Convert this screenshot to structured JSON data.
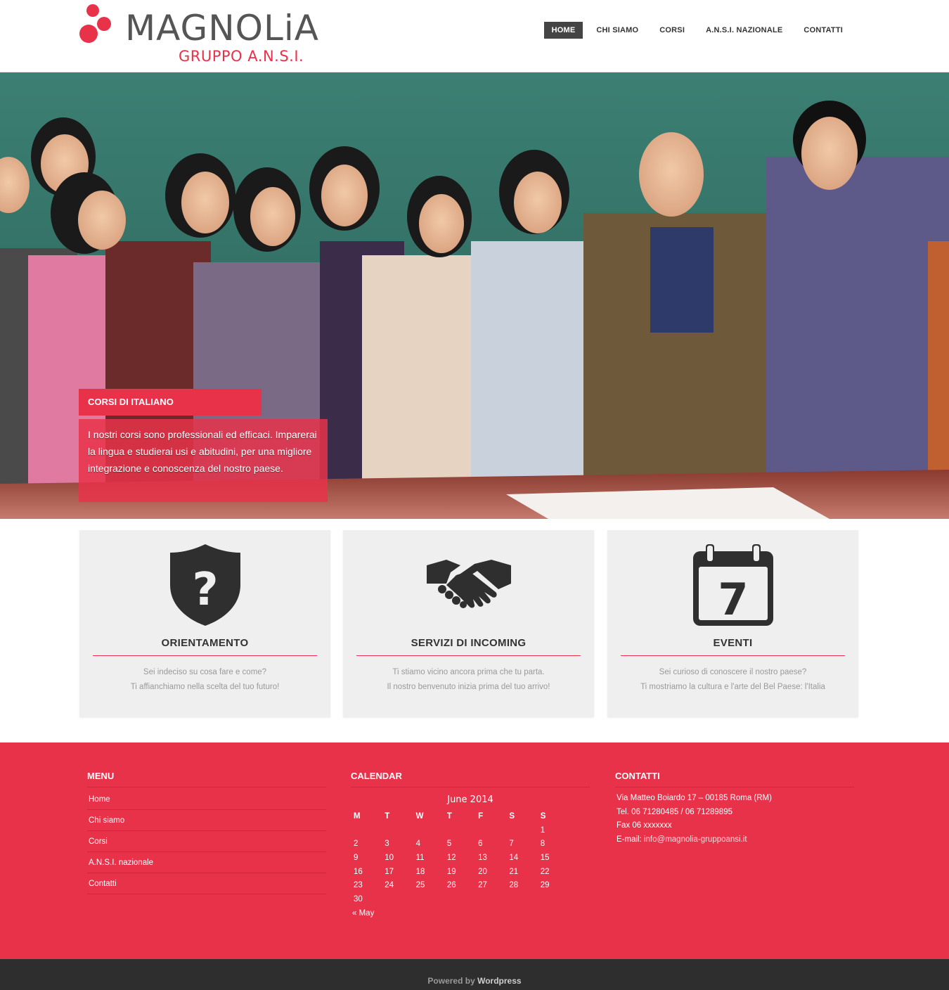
{
  "header": {
    "logo_title": "MAGNOLiA",
    "logo_subtitle": "GRUPPO A.N.S.I.",
    "nav": [
      {
        "label": "HOME",
        "active": true
      },
      {
        "label": "CHI SIAMO",
        "active": false
      },
      {
        "label": "CORSI",
        "active": false
      },
      {
        "label": "A.N.S.I. NAZIONALE",
        "active": false
      },
      {
        "label": "CONTATTI",
        "active": false
      }
    ]
  },
  "hero": {
    "caption_title": "CORSI DI ITALIANO",
    "caption_body": "I nostri corsi sono professionali ed efficaci. Imparerai la lingua e studierai usi e abitudini, per una migliore integrazione e conoscenza del nostro paese."
  },
  "features": [
    {
      "title": "ORIENTAMENTO",
      "icon": "shield-question-icon",
      "line1": "Sei indeciso su cosa fare e come?",
      "line2": "Ti affianchiamo nella scelta del tuo futuro!"
    },
    {
      "title": "SERVIZI DI INCOMING",
      "icon": "handshake-icon",
      "line1": "Ti stiamo vicino ancora prima che tu parta.",
      "line2": "Il nostro benvenuto inizia prima del tuo arrivo!"
    },
    {
      "title": "EVENTI",
      "icon": "calendar-icon",
      "line1": "Sei curioso di conoscere il nostro paese?",
      "line2": "Ti mostriamo la cultura e l'arte del Bel Paese: l'Italia",
      "calendar_number": "7"
    }
  ],
  "footer": {
    "menu_title": "MENU",
    "menu_items": [
      "Home",
      "Chi siamo",
      "Corsi",
      "A.N.S.I. nazionale",
      "Contatti"
    ],
    "calendar_title": "CALENDAR",
    "calendar_month": "June 2014",
    "calendar_days": [
      "M",
      "T",
      "W",
      "T",
      "F",
      "S",
      "S"
    ],
    "calendar_rows": [
      [
        "",
        "",
        "",
        "",
        "",
        "",
        "1"
      ],
      [
        "2",
        "3",
        "4",
        "5",
        "6",
        "7",
        "8"
      ],
      [
        "9",
        "10",
        "11",
        "12",
        "13",
        "14",
        "15"
      ],
      [
        "16",
        "17",
        "18",
        "19",
        "20",
        "21",
        "22"
      ],
      [
        "23",
        "24",
        "25",
        "26",
        "27",
        "28",
        "29"
      ],
      [
        "30",
        "",
        "",
        "",
        "",
        "",
        ""
      ]
    ],
    "calendar_prev": "« May",
    "contacts_title": "CONTATTI",
    "address": "Via Matteo Boiardo 17 – 00185 Roma (RM)",
    "tel": "Tel. 06 71280485 / 06 71289895",
    "fax": "Fax 06 xxxxxxx",
    "email_label": "E-mail:",
    "email": "info@magnolia-gruppoansi.it"
  },
  "bottombar": {
    "powered": "Powered by",
    "wordpress": "Wordpress"
  },
  "colors": {
    "accent": "#e8324a",
    "dark": "#2e2e2e",
    "box_bg": "#efefef"
  }
}
